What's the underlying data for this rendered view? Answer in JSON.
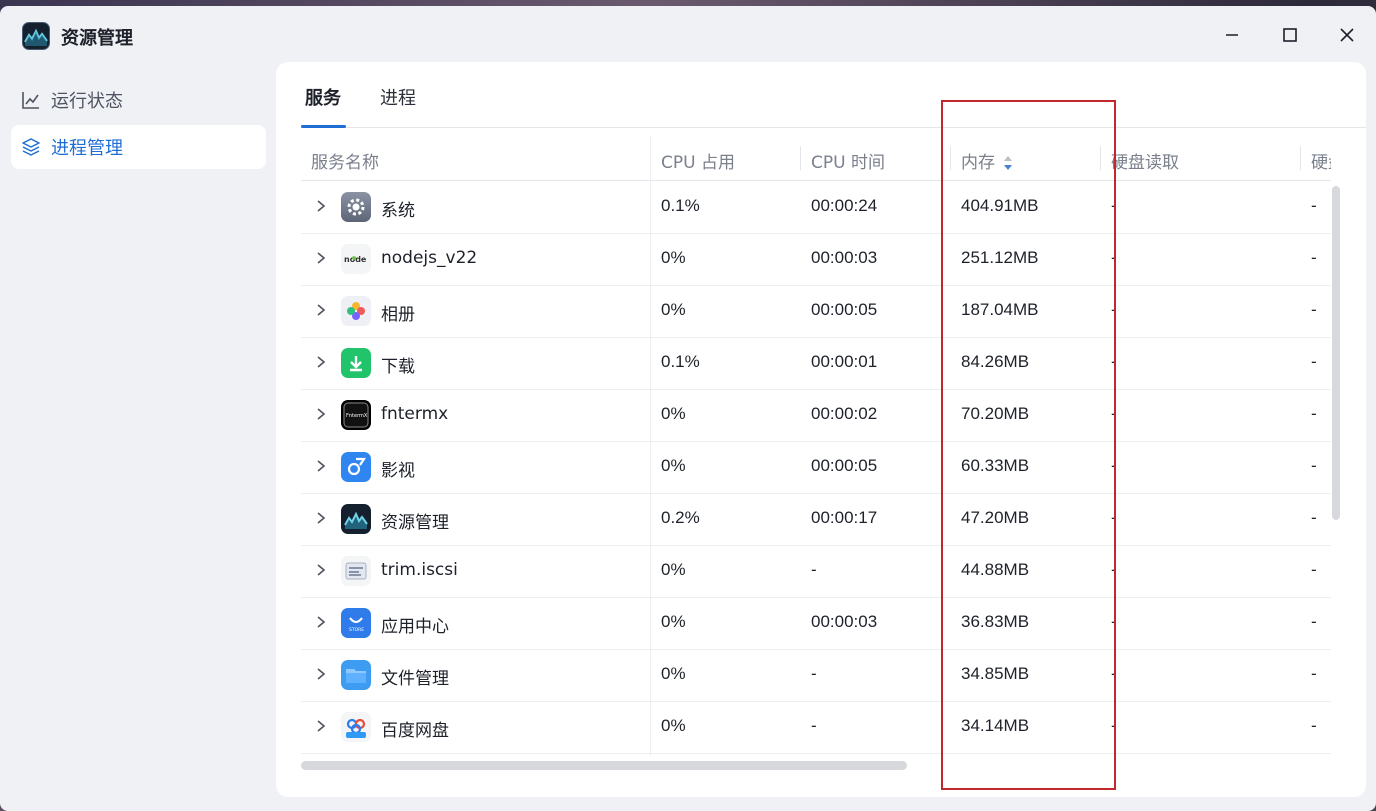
{
  "window": {
    "title": "资源管理"
  },
  "sidebar": {
    "items": [
      {
        "label": "运行状态",
        "icon": "line-chart-icon",
        "active": false
      },
      {
        "label": "进程管理",
        "icon": "layers-icon",
        "active": true
      }
    ]
  },
  "tabs": [
    {
      "label": "服务",
      "active": true
    },
    {
      "label": "进程",
      "active": false
    }
  ],
  "table": {
    "columns": [
      "服务名称",
      "CPU 占用",
      "CPU 时间",
      "内存",
      "硬盘读取",
      "硬盘"
    ],
    "sorted_column": "内存",
    "rows": [
      {
        "name": "系统",
        "icon": "gear-icon",
        "cpu": "0.1%",
        "time": "00:00:24",
        "mem": "404.91MB",
        "read": "-",
        "write": "-"
      },
      {
        "name": "nodejs_v22",
        "icon": "node-icon",
        "cpu": "0%",
        "time": "00:00:03",
        "mem": "251.12MB",
        "read": "-",
        "write": "-"
      },
      {
        "name": "相册",
        "icon": "photos-icon",
        "cpu": "0%",
        "time": "00:00:05",
        "mem": "187.04MB",
        "read": "-",
        "write": "-"
      },
      {
        "name": "下载",
        "icon": "download-icon",
        "cpu": "0.1%",
        "time": "00:00:01",
        "mem": "84.26MB",
        "read": "-",
        "write": "-"
      },
      {
        "name": "fntermx",
        "icon": "terminal-icon",
        "cpu": "0%",
        "time": "00:00:02",
        "mem": "70.20MB",
        "read": "-",
        "write": "-"
      },
      {
        "name": "影视",
        "icon": "video-icon",
        "cpu": "0%",
        "time": "00:00:05",
        "mem": "60.33MB",
        "read": "-",
        "write": "-"
      },
      {
        "name": "资源管理",
        "icon": "monitor-icon",
        "cpu": "0.2%",
        "time": "00:00:17",
        "mem": "47.20MB",
        "read": "-",
        "write": "-"
      },
      {
        "name": "trim.iscsi",
        "icon": "iscsi-icon",
        "cpu": "0%",
        "time": "-",
        "mem": "44.88MB",
        "read": "-",
        "write": "-"
      },
      {
        "name": "应用中心",
        "icon": "store-icon",
        "cpu": "0%",
        "time": "00:00:03",
        "mem": "36.83MB",
        "read": "-",
        "write": "-"
      },
      {
        "name": "文件管理",
        "icon": "folder-icon",
        "cpu": "0%",
        "time": "-",
        "mem": "34.85MB",
        "read": "-",
        "write": "-"
      },
      {
        "name": "百度网盘",
        "icon": "cloud-icon",
        "cpu": "0%",
        "time": "-",
        "mem": "34.14MB",
        "read": "-",
        "write": "-"
      }
    ]
  },
  "colors": {
    "accent": "#1f6ed4",
    "highlight_box": "#c0282d"
  }
}
